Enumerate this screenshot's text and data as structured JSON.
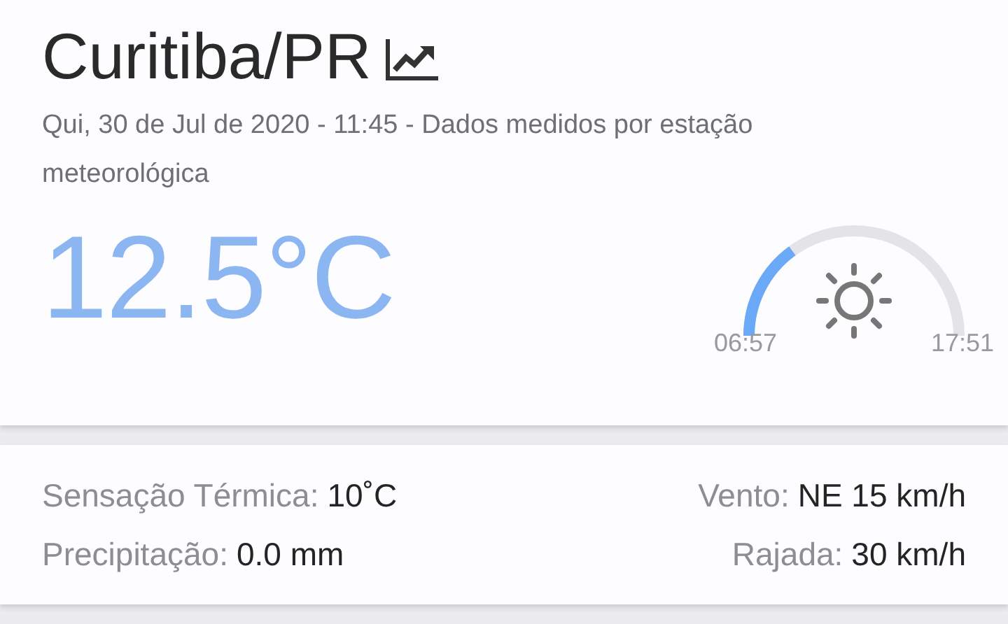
{
  "location": {
    "title": "Curitiba/PR",
    "subtitle": "Qui, 30 de Jul de 2020 - 11:45 - Dados medidos por estação meteorológica"
  },
  "current": {
    "temperature": "12.5°C",
    "sun": {
      "sunrise": "06:57",
      "sunset": "17:51"
    }
  },
  "details": {
    "left_column": [
      {
        "label": "Sensação Térmica:",
        "value": "10˚C"
      },
      {
        "label": "Precipitação:",
        "value": "0.0 mm"
      }
    ],
    "right_column": [
      {
        "label": "Vento:",
        "value": "NE 15 km/h"
      },
      {
        "label": "Rajada:",
        "value": "30 km/h"
      }
    ]
  }
}
